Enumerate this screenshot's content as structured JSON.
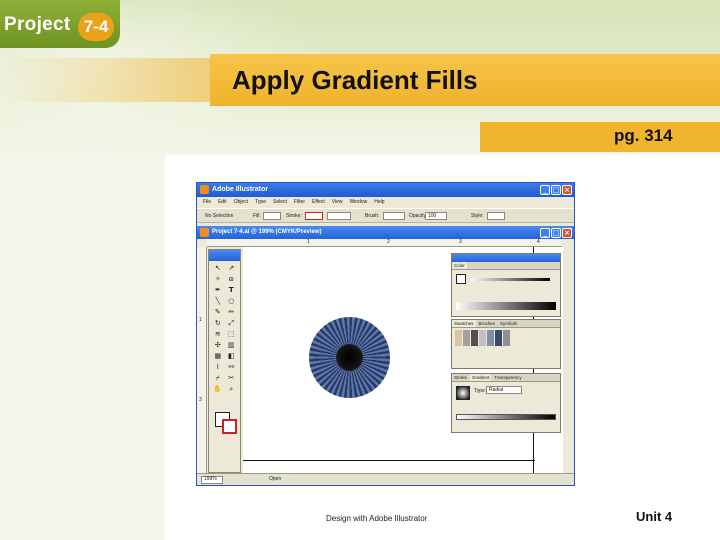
{
  "slide": {
    "project_word": "Project",
    "project_number": "7-4",
    "title": "Apply Gradient Fills",
    "page_ref": "pg. 314",
    "footer_credit": "Design with Adobe Illustrator",
    "footer_unit": "Unit 4"
  },
  "app": {
    "title": "Adobe Illustrator",
    "menus": [
      "File",
      "Edit",
      "Object",
      "Type",
      "Select",
      "Filter",
      "Effect",
      "View",
      "Window",
      "Help"
    ],
    "control": {
      "selection": "No Selection",
      "fill_label": "Fill:",
      "stroke_label": "Stroke:",
      "brush_label": "Brush:",
      "opacity_label": "Opacity:",
      "opacity_value": "100",
      "style_label": "Style:"
    },
    "document_title": "Project 7-4.ai @ 199% (CMYK/Preview)",
    "ruler_numbers": [
      "1",
      "2",
      "3",
      "4"
    ],
    "left_ruler_numbers": [
      "1",
      "3"
    ],
    "panels": {
      "color_tab": "Color",
      "swatches_tabs": [
        "Swatches",
        "Brushes",
        "Symbols"
      ],
      "gradient_tabs": [
        "Stroke",
        "Gradient",
        "Transparency"
      ],
      "gradient_type_label": "Type:",
      "gradient_type_value": "Radial"
    },
    "status": {
      "zoom": "199%",
      "mode": "Open"
    },
    "colors": {
      "titlebar": "#1f5ad6",
      "iris_dark": "#2b3a5c",
      "iris_light": "#5a78b4",
      "slide_orange": "#f0b22c",
      "slide_green": "#6f9322"
    }
  }
}
